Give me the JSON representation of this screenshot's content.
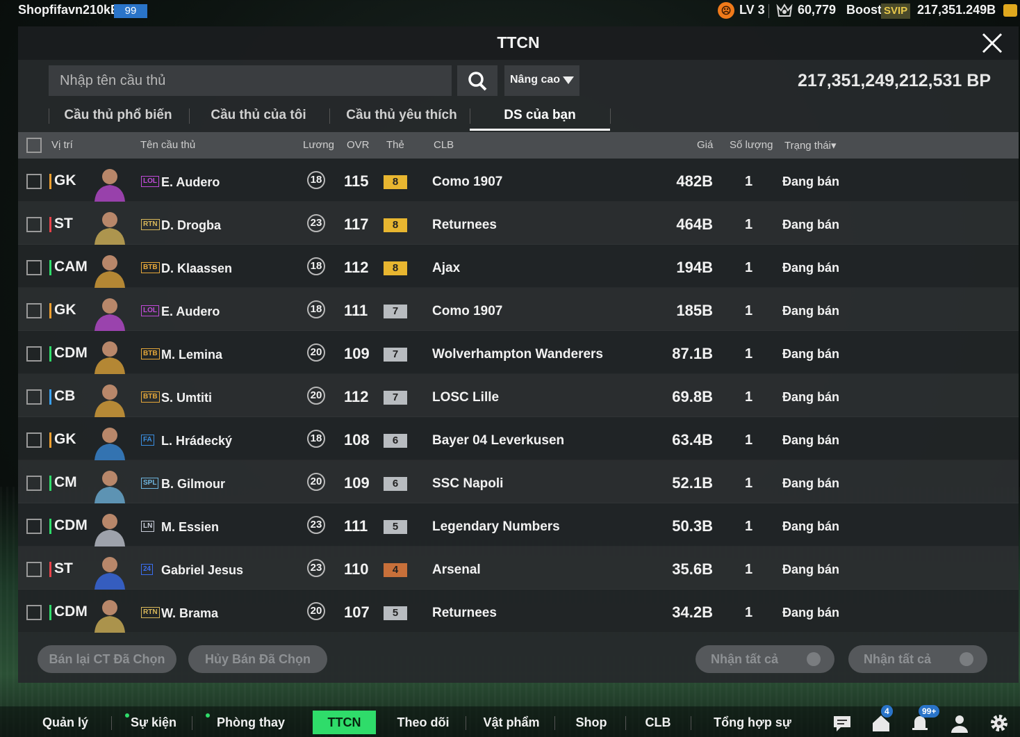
{
  "topbar": {
    "user_name": "Shopfifavn210kB",
    "user_level": "99",
    "rank_level": "LV 3",
    "points": "60,779",
    "boost_label": "Boost",
    "svip_label": "SVIP",
    "bp_short": "217,351.249B"
  },
  "panel": {
    "title": "TTCN",
    "search_placeholder": "Nhập tên cầu thủ",
    "advanced_label": "Nâng cao",
    "bp_total": "217,351,249,212,531 BP",
    "tabs": [
      {
        "label": "Cầu thủ phổ biến"
      },
      {
        "label": "Cầu thủ của tôi"
      },
      {
        "label": "Cầu thủ yêu thích"
      },
      {
        "label": "DS của bạn"
      }
    ],
    "active_tab": "DS của bạn",
    "columns": {
      "position": "Vị trí",
      "name": "Tên cầu thủ",
      "salary": "Lương",
      "ovr": "OVR",
      "grade": "Thẻ",
      "club": "CLB",
      "price": "Giá",
      "quantity": "Số lượng",
      "status": "Trạng thái▾"
    },
    "rows": [
      {
        "pos": "GK",
        "pos_color": "#f0a030",
        "season": "LOL",
        "season_color": "#c04bd8",
        "name": "E. Audero",
        "salary": "18",
        "ovr": "115",
        "grade": "8",
        "grade_color": "#e8b630",
        "club": "Como 1907",
        "price": "482B",
        "qty": "1",
        "status": "Đang bán"
      },
      {
        "pos": "ST",
        "pos_color": "#e8424a",
        "season": "RTN",
        "season_color": "#d9b85a",
        "name": "D. Drogba",
        "salary": "23",
        "ovr": "117",
        "grade": "8",
        "grade_color": "#e8b630",
        "club": "Returnees",
        "price": "464B",
        "qty": "1",
        "status": "Đang bán"
      },
      {
        "pos": "CAM",
        "pos_color": "#2fdc6a",
        "season": "BTB",
        "season_color": "#e6a83a",
        "name": "D. Klaassen",
        "salary": "18",
        "ovr": "112",
        "grade": "8",
        "grade_color": "#e8b630",
        "club": "Ajax",
        "price": "194B",
        "qty": "1",
        "status": "Đang bán"
      },
      {
        "pos": "GK",
        "pos_color": "#f0a030",
        "season": "LOL",
        "season_color": "#c04bd8",
        "name": "E. Audero",
        "salary": "18",
        "ovr": "111",
        "grade": "7",
        "grade_color": "#b8bcc0",
        "club": "Como 1907",
        "price": "185B",
        "qty": "1",
        "status": "Đang bán"
      },
      {
        "pos": "CDM",
        "pos_color": "#2fdc6a",
        "season": "BTB",
        "season_color": "#e6a83a",
        "name": "M. Lemina",
        "salary": "20",
        "ovr": "109",
        "grade": "7",
        "grade_color": "#b8bcc0",
        "club": "Wolverhampton Wanderers",
        "price": "87.1B",
        "qty": "1",
        "status": "Đang bán"
      },
      {
        "pos": "CB",
        "pos_color": "#3aa0f0",
        "season": "BTB",
        "season_color": "#e6a83a",
        "name": "S. Umtiti",
        "salary": "20",
        "ovr": "112",
        "grade": "7",
        "grade_color": "#b8bcc0",
        "club": "LOSC Lille",
        "price": "69.8B",
        "qty": "1",
        "status": "Đang bán"
      },
      {
        "pos": "GK",
        "pos_color": "#f0a030",
        "season": "FA",
        "season_color": "#3a8ee0",
        "name": "L. Hrádecký",
        "salary": "18",
        "ovr": "108",
        "grade": "6",
        "grade_color": "#b8bcc0",
        "club": "Bayer 04 Leverkusen",
        "price": "63.4B",
        "qty": "1",
        "status": "Đang bán"
      },
      {
        "pos": "CM",
        "pos_color": "#2fdc6a",
        "season": "SPL",
        "season_color": "#6fb6e0",
        "name": "B. Gilmour",
        "salary": "20",
        "ovr": "109",
        "grade": "6",
        "grade_color": "#b8bcc0",
        "club": "SSC Napoli",
        "price": "52.1B",
        "qty": "1",
        "status": "Đang bán"
      },
      {
        "pos": "CDM",
        "pos_color": "#2fdc6a",
        "season": "LN",
        "season_color": "#c8ccd8",
        "name": "M. Essien",
        "salary": "23",
        "ovr": "111",
        "grade": "5",
        "grade_color": "#b8bcc0",
        "club": "Legendary Numbers",
        "price": "50.3B",
        "qty": "1",
        "status": "Đang bán"
      },
      {
        "pos": "ST",
        "pos_color": "#e8424a",
        "season": "24",
        "season_color": "#3a6ef0",
        "name": "Gabriel Jesus",
        "salary": "23",
        "ovr": "110",
        "grade": "4",
        "grade_color": "#c8703a",
        "club": "Arsenal",
        "price": "35.6B",
        "qty": "1",
        "status": "Đang bán"
      },
      {
        "pos": "CDM",
        "pos_color": "#2fdc6a",
        "season": "RTN",
        "season_color": "#d9b85a",
        "name": "W. Brama",
        "salary": "20",
        "ovr": "107",
        "grade": "5",
        "grade_color": "#b8bcc0",
        "club": "Returnees",
        "price": "34.2B",
        "qty": "1",
        "status": "Đang bán"
      }
    ],
    "actions": {
      "resell": "Bán lại CT Đã Chọn",
      "cancel": "Hủy Bán Đã Chọn",
      "claim_all_1": "Nhận tất cả",
      "claim_all_2": "Nhận tất cả"
    }
  },
  "bottom_nav": {
    "items": [
      {
        "label": "Quản lý CT"
      },
      {
        "label": "Sự kiện"
      },
      {
        "label": "Phòng thay đồ"
      },
      {
        "label": "TTCN"
      },
      {
        "label": "Theo dõi"
      },
      {
        "label": "Vật phẩm"
      },
      {
        "label": "Shop"
      },
      {
        "label": "CLB"
      },
      {
        "label": "Tổng hợp sự kiện"
      }
    ],
    "home_badge": "4",
    "notif_badge": "99+"
  },
  "colors": {
    "accent": "#2fdc6a",
    "level_badge": "#2a74c9"
  },
  "icons": [
    "search-icon",
    "close-icon",
    "chevron-down-icon",
    "chat-icon",
    "home-icon",
    "bell-icon",
    "user-icon",
    "gear-icon",
    "crown-icon",
    "coin-icon"
  ]
}
